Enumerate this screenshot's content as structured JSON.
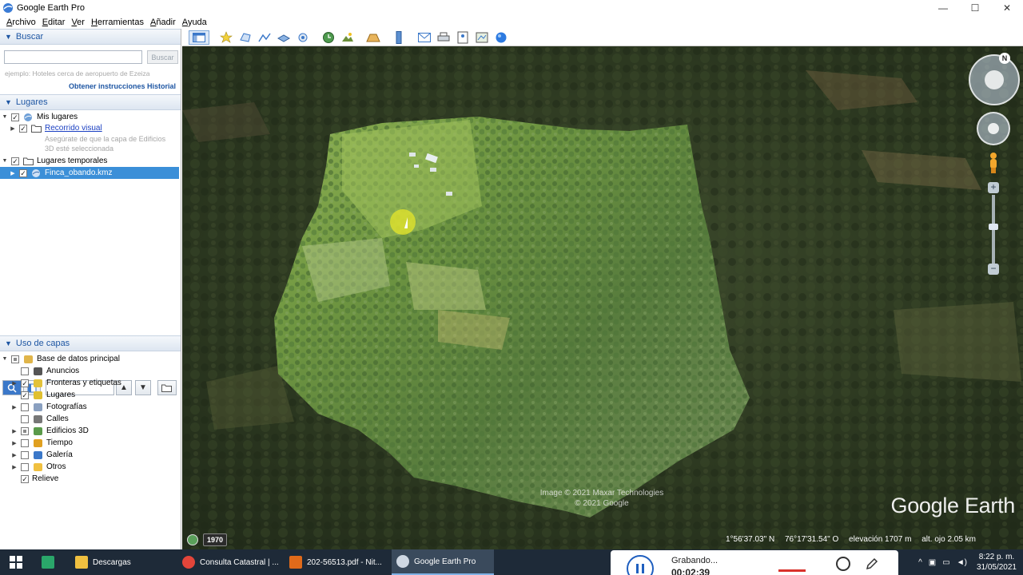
{
  "window": {
    "title": "Google Earth Pro",
    "controls": {
      "minimize": "—",
      "maximize": "☐",
      "close": "✕"
    }
  },
  "menu": [
    "Archivo",
    "Editar",
    "Ver",
    "Herramientas",
    "Añadir",
    "Ayuda"
  ],
  "search": {
    "header": "Buscar",
    "placeholder": "",
    "button": "Buscar",
    "hint": "ejemplo: Hoteles cerca de aeropuerto de Ezeiza",
    "directions_link": "Obtener instrucciones",
    "history_link": "Historial"
  },
  "places": {
    "header": "Lugares",
    "my_places": "Mis lugares",
    "tour": "Recorrido visual",
    "tour_note_1": "Asegúrate de que la capa de Edificios",
    "tour_note_2": "3D esté seleccionada",
    "temp_places": "Lugares temporales",
    "kmz": "Finca_obando.kmz"
  },
  "layers": {
    "header": "Uso de capas",
    "items": [
      {
        "label": "Base de datos principal",
        "checked": "partial",
        "icon": "layers-icon"
      },
      {
        "label": "Anuncios",
        "checked": false,
        "icon": "mail-icon"
      },
      {
        "label": "Fronteras y etiquetas",
        "checked": true,
        "icon": "borders-icon"
      },
      {
        "label": "Lugares",
        "checked": true,
        "icon": "places-icon"
      },
      {
        "label": "Fotografías",
        "checked": false,
        "icon": "photo-icon"
      },
      {
        "label": "Calles",
        "checked": false,
        "icon": "roads-icon"
      },
      {
        "label": "Edificios 3D",
        "checked": "partial",
        "icon": "buildings-icon"
      },
      {
        "label": "Tiempo",
        "checked": false,
        "icon": "weather-icon"
      },
      {
        "label": "Galería",
        "checked": false,
        "icon": "gallery-icon"
      },
      {
        "label": "Otros",
        "checked": false,
        "icon": "folder-icon"
      },
      {
        "label": "Relieve",
        "checked": true,
        "icon": ""
      }
    ]
  },
  "map": {
    "attribution_1": "Image © 2021 Maxar Technologies",
    "attribution_2": "© 2021 Google",
    "logo": "Google Earth",
    "year": "1970",
    "lat": "1°56'37.03\" N",
    "lon": "76°17'31.54\" O",
    "elevation": "elevación  1707 m",
    "eye_alt": "alt. ojo   2.05 km",
    "compass_n": "N"
  },
  "taskbar": {
    "items": [
      "Descargas",
      "Consulta Catastral | ...",
      "202-56513.pdf - Nit...",
      "Google Earth Pro"
    ],
    "recording_label": "Grabando...",
    "recording_time": "00:02:39",
    "time": "8:22 p. m.",
    "date": "31/05/2021"
  },
  "colors": {
    "header_blue": "#1e56a3",
    "selected": "#3b8fd8",
    "taskbar": "#1e2a38"
  }
}
